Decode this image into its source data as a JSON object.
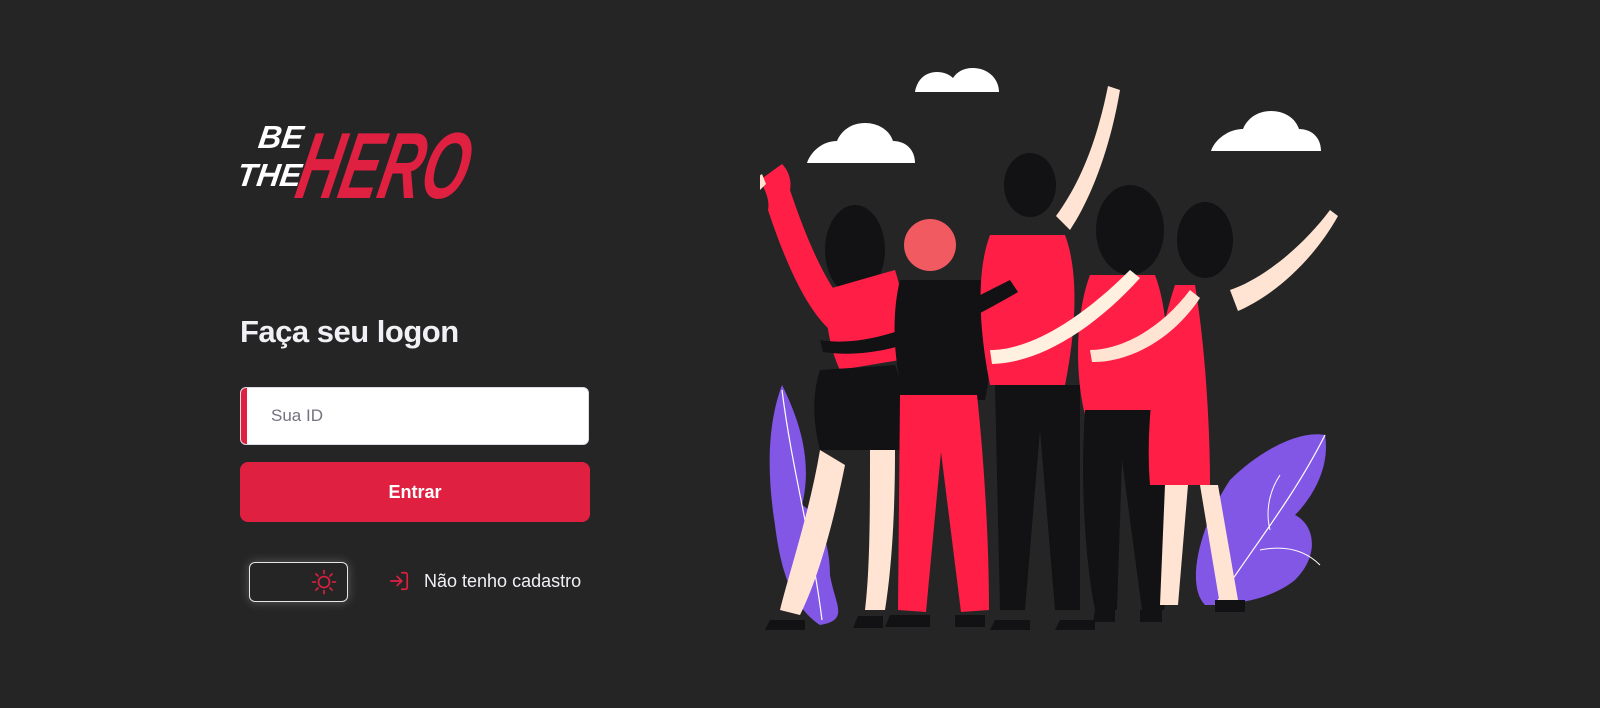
{
  "logo": {
    "line1": "BE",
    "line2": "THE",
    "word": "HERO"
  },
  "login": {
    "title": "Faça seu logon",
    "id_placeholder": "Sua ID",
    "id_value": "",
    "submit_label": "Entrar"
  },
  "theme_toggle": {
    "icon": "sun-icon"
  },
  "register_link": {
    "label": "Não tenho cadastro",
    "icon": "log-in-icon"
  },
  "colors": {
    "accent": "#e02041",
    "background": "#262526",
    "text": "#f0f0f5",
    "leaf": "#8257e5"
  }
}
